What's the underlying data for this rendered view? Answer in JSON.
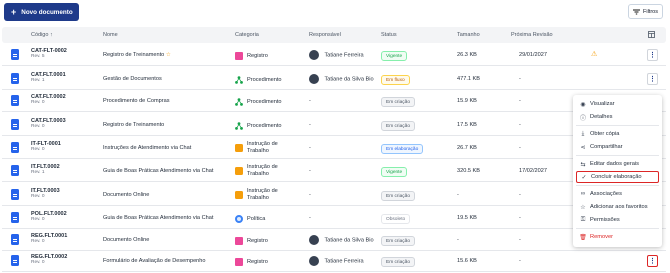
{
  "toolbar": {
    "new_label": "Novo documento",
    "filter_label": "Filtros"
  },
  "columns": [
    "Código",
    "Nome",
    "Categoria",
    "Responsável",
    "Status",
    "Tamanho",
    "Próxima Revisão"
  ],
  "rows": [
    {
      "code": "CAT-FLT-0002",
      "rev": "Rev. 5",
      "name": "Registro de Treinamento",
      "name_mark": "☆",
      "category": "Registro",
      "cat_type": "folder",
      "owner": "Tatiane Ferreira",
      "status": "Vigente",
      "status_type": "vig",
      "size": "26.3 KB",
      "review": "29/01/2027",
      "warn": "⚠"
    },
    {
      "code": "CAT.FLT.0001",
      "rev": "Rev. 1",
      "name": "Gestão de Documentos",
      "name_mark": "",
      "category": "Procedimento",
      "cat_type": "proc",
      "owner": "Tatiane da Silva Bio",
      "status": "Em fluxo",
      "status_type": "fluxo",
      "size": "477.1 KB",
      "review": "-",
      "warn": ""
    },
    {
      "code": "CAT.FLT.0002",
      "rev": "Rev. 0",
      "name": "Procedimento de Compras",
      "name_mark": "",
      "category": "Procedimento",
      "cat_type": "proc",
      "owner": "-",
      "status": "Em criação",
      "status_type": "cria",
      "size": "15.9 KB",
      "review": "-",
      "warn": ""
    },
    {
      "code": "CAT.FLT.0003",
      "rev": "Rev. 0",
      "name": "Registro de Treinamento",
      "name_mark": "",
      "category": "Procedimento",
      "cat_type": "proc",
      "owner": "-",
      "status": "Em criação",
      "status_type": "cria",
      "size": "17.5 KB",
      "review": "-",
      "warn": ""
    },
    {
      "code": "IT-FLT-0001",
      "rev": "Rev. 0",
      "name": "Instruções de Atendimento via Chat",
      "name_mark": "",
      "category": "Instrução de Trabalho",
      "cat_type": "instr",
      "owner": "-",
      "status": "Em elaboração",
      "status_type": "elab",
      "size": "26.7 KB",
      "review": "-",
      "warn": ""
    },
    {
      "code": "IT.FLT.0002",
      "rev": "Rev. 1",
      "name": "Guia de Boas Práticas Atendimento via Chat",
      "name_mark": "",
      "category": "Instrução de Trabalho",
      "cat_type": "instr",
      "owner": "-",
      "status": "Vigente",
      "status_type": "vig",
      "size": "320.5 KB",
      "review": "17/02/2027",
      "warn": ""
    },
    {
      "code": "IT.FLT.0003",
      "rev": "Rev. 0",
      "name": "Documento Online",
      "name_mark": "",
      "category": "Instrução de Trabalho",
      "cat_type": "instr",
      "owner": "-",
      "status": "Em criação",
      "status_type": "cria",
      "size": "-",
      "review": "-",
      "warn": ""
    },
    {
      "code": "POL.FLT.0002",
      "rev": "Rev. 0",
      "name": "Guia de Boas Práticas Atendimento via Chat",
      "name_mark": "",
      "category": "Política",
      "cat_type": "policy",
      "owner": "-",
      "status": "Obsoleto",
      "status_type": "obs",
      "size": "19.5 KB",
      "review": "-",
      "warn": ""
    },
    {
      "code": "REG.FLT.0001",
      "rev": "Rev. 0",
      "name": "Documento Online",
      "name_mark": "",
      "category": "Registro",
      "cat_type": "folder",
      "owner": "Tatiane da Silva Bio",
      "status": "Em criação",
      "status_type": "cria",
      "size": "-",
      "review": "-",
      "warn": ""
    },
    {
      "code": "REG.FLT.0002",
      "rev": "Rev. 0",
      "name": "Formulário de Avaliação de Desempenho",
      "name_mark": "",
      "category": "Registro",
      "cat_type": "folder",
      "owner": "Tatiane Ferreira",
      "status": "Em criação",
      "status_type": "cria",
      "size": "15.6 KB",
      "review": "-",
      "warn": ""
    }
  ],
  "menu": [
    {
      "label": "Visualizar",
      "icon": "eye-icon",
      "glyph": "◉"
    },
    {
      "label": "Detalhes",
      "icon": "info-icon",
      "glyph": "ⓘ"
    },
    {
      "label": "Obter cópia",
      "icon": "download-icon",
      "glyph": "⤓"
    },
    {
      "label": "Compartilhar",
      "icon": "share-icon",
      "glyph": "⋖"
    },
    {
      "label": "Editar dados gerais",
      "icon": "sliders-icon",
      "glyph": "⇆"
    },
    {
      "label": "Concluir elaboração",
      "icon": "check-circle-icon",
      "glyph": "✓"
    },
    {
      "label": "Associações",
      "icon": "link-icon",
      "glyph": "∞"
    },
    {
      "label": "Adicionar aos favoritos",
      "icon": "star-icon",
      "glyph": "☆"
    },
    {
      "label": "Permissões",
      "icon": "lock-icon",
      "glyph": "⚿"
    },
    {
      "label": "Remover",
      "icon": "trash-icon",
      "glyph": "🗑"
    }
  ],
  "colors": {
    "primary": "#1e3a8a",
    "highlight": "#dc2626"
  }
}
